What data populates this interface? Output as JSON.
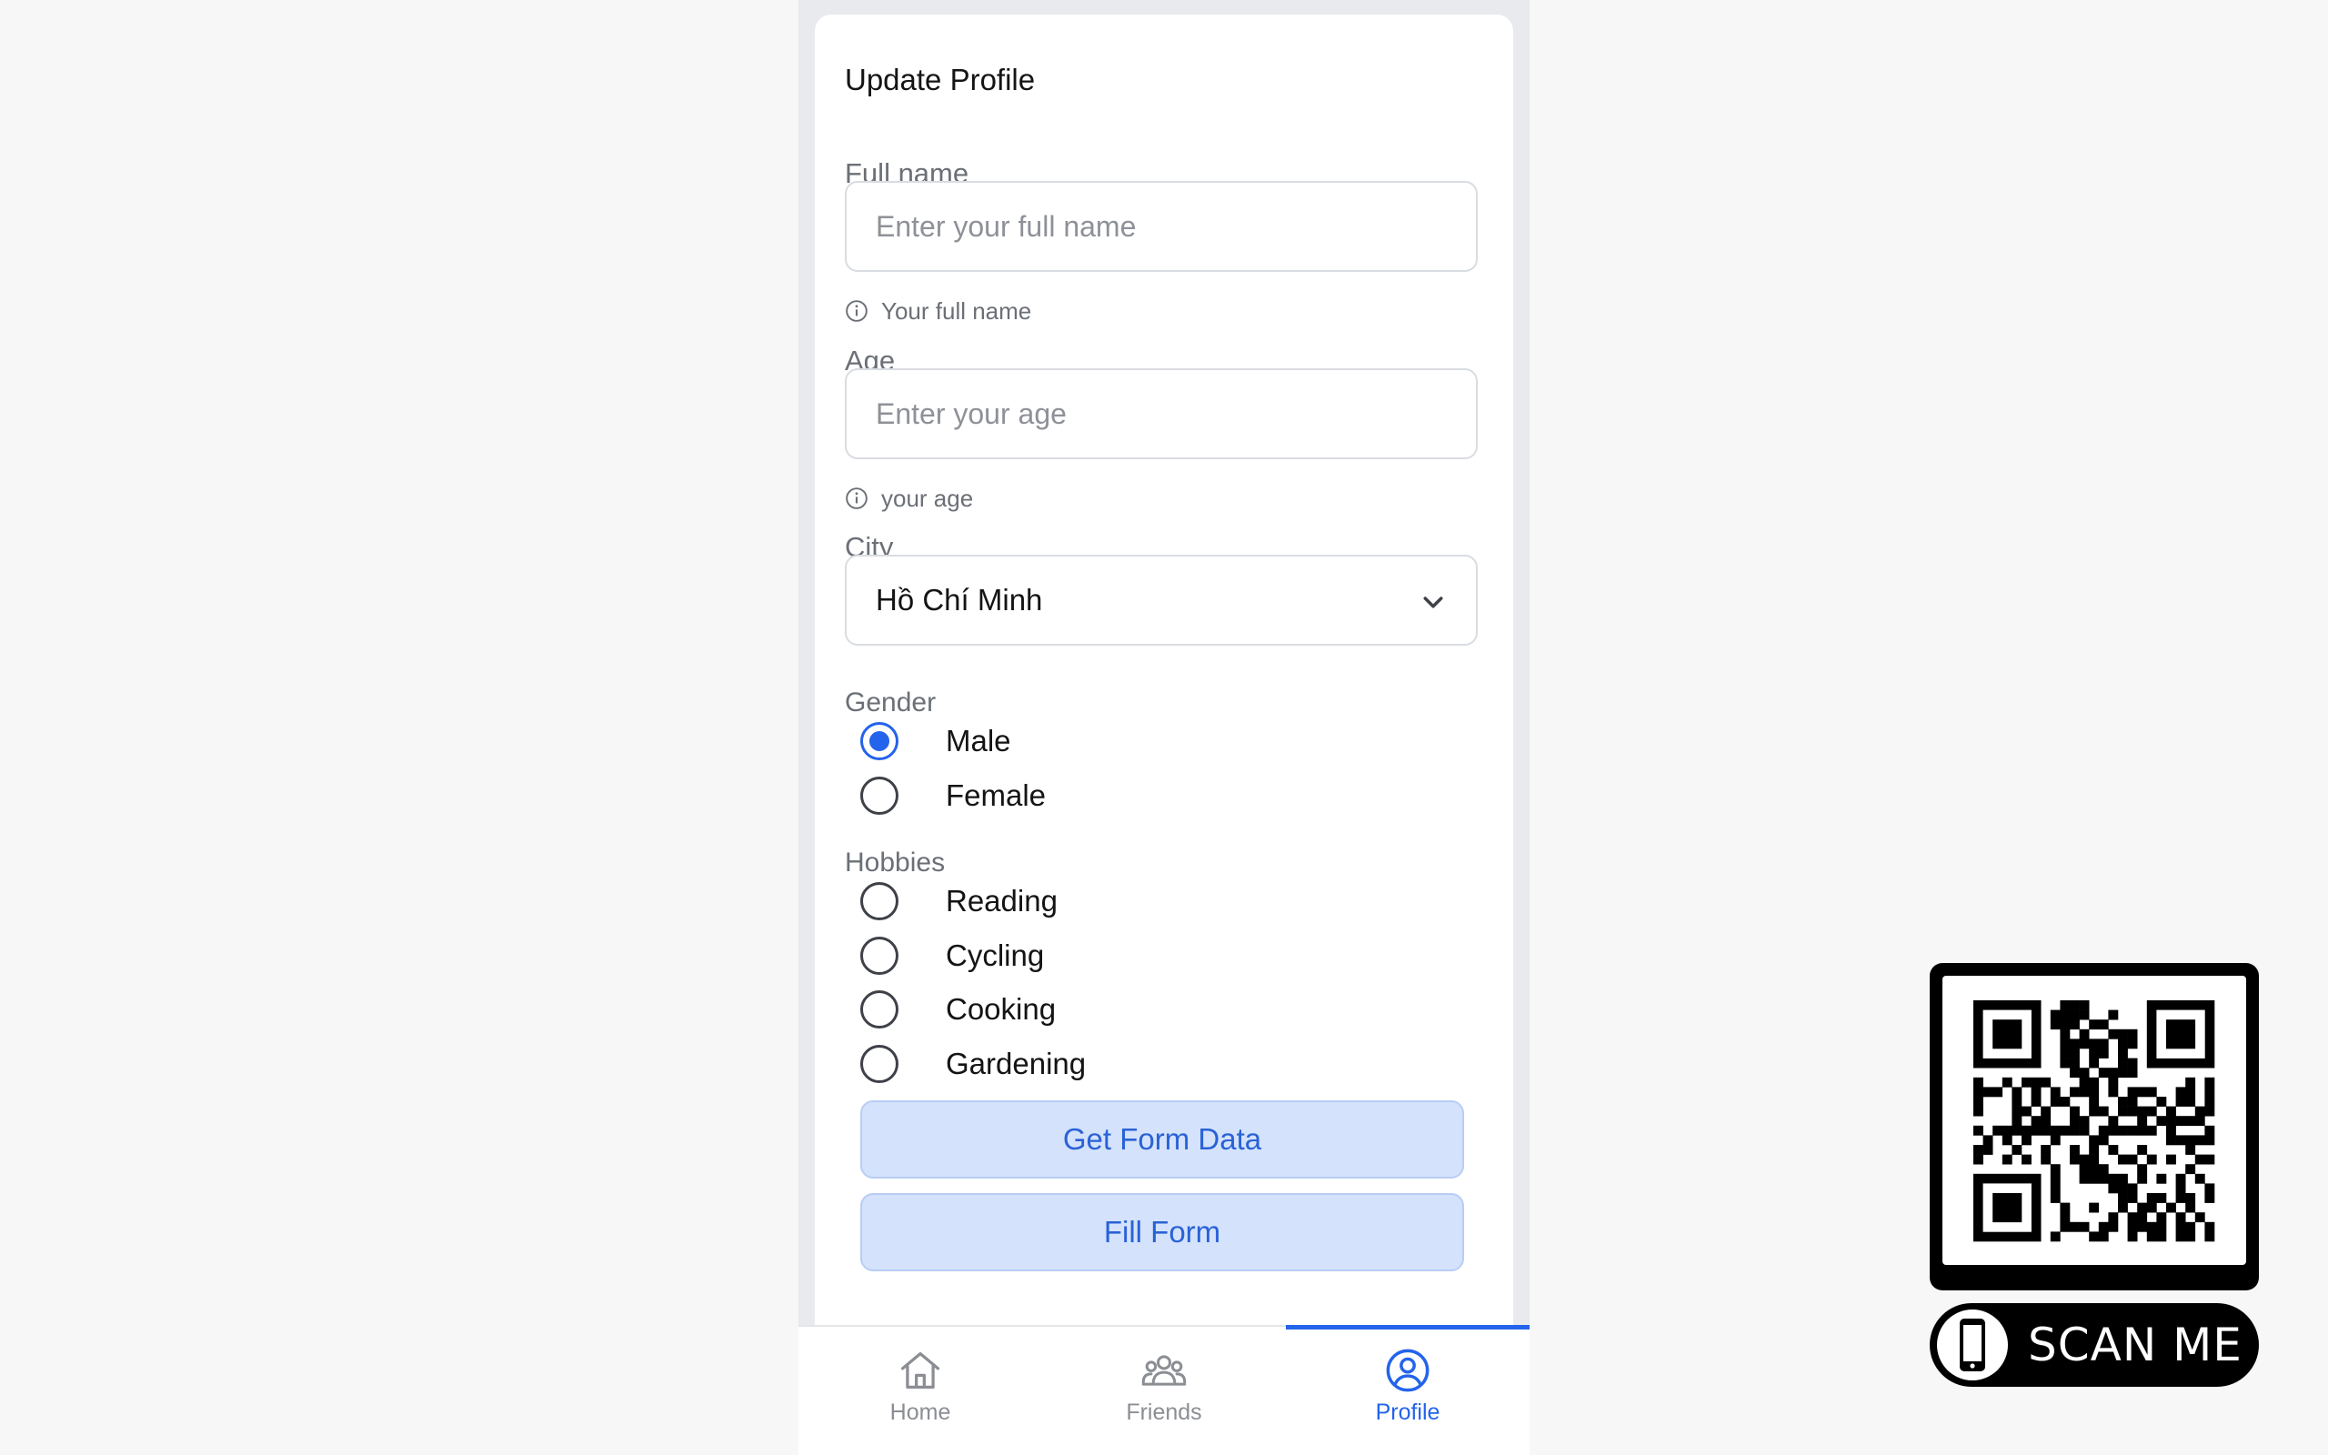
{
  "form": {
    "title": "Update Profile",
    "full_name": {
      "label": "Full name",
      "placeholder": "Enter your full name",
      "value": "",
      "helper": "Your full name"
    },
    "age": {
      "label": "Age",
      "placeholder": "Enter your age",
      "value": "",
      "helper": "your age"
    },
    "city": {
      "label": "City",
      "selected": "Hồ Chí Minh"
    },
    "gender": {
      "label": "Gender",
      "options": [
        {
          "label": "Male",
          "checked": true
        },
        {
          "label": "Female",
          "checked": false
        }
      ]
    },
    "hobbies": {
      "label": "Hobbies",
      "options": [
        {
          "label": "Reading",
          "checked": false
        },
        {
          "label": "Cycling",
          "checked": false
        },
        {
          "label": "Cooking",
          "checked": false
        },
        {
          "label": "Gardening",
          "checked": false
        }
      ]
    },
    "buttons": {
      "get_form_data": "Get Form Data",
      "fill_form": "Fill Form"
    }
  },
  "bottom_nav": {
    "active": "Profile",
    "items": [
      {
        "label": "Home",
        "icon": "home-icon"
      },
      {
        "label": "Friends",
        "icon": "friends-icon"
      },
      {
        "label": "Profile",
        "icon": "profile-icon"
      }
    ]
  },
  "qr_widget": {
    "caption": "SCAN ME",
    "icon": "smartphone-icon"
  },
  "colors": {
    "accent": "#2463eb",
    "button_bg": "#d4e2fb",
    "page_bg": "#f7f7f8",
    "frame_bg": "#e8eaed"
  }
}
